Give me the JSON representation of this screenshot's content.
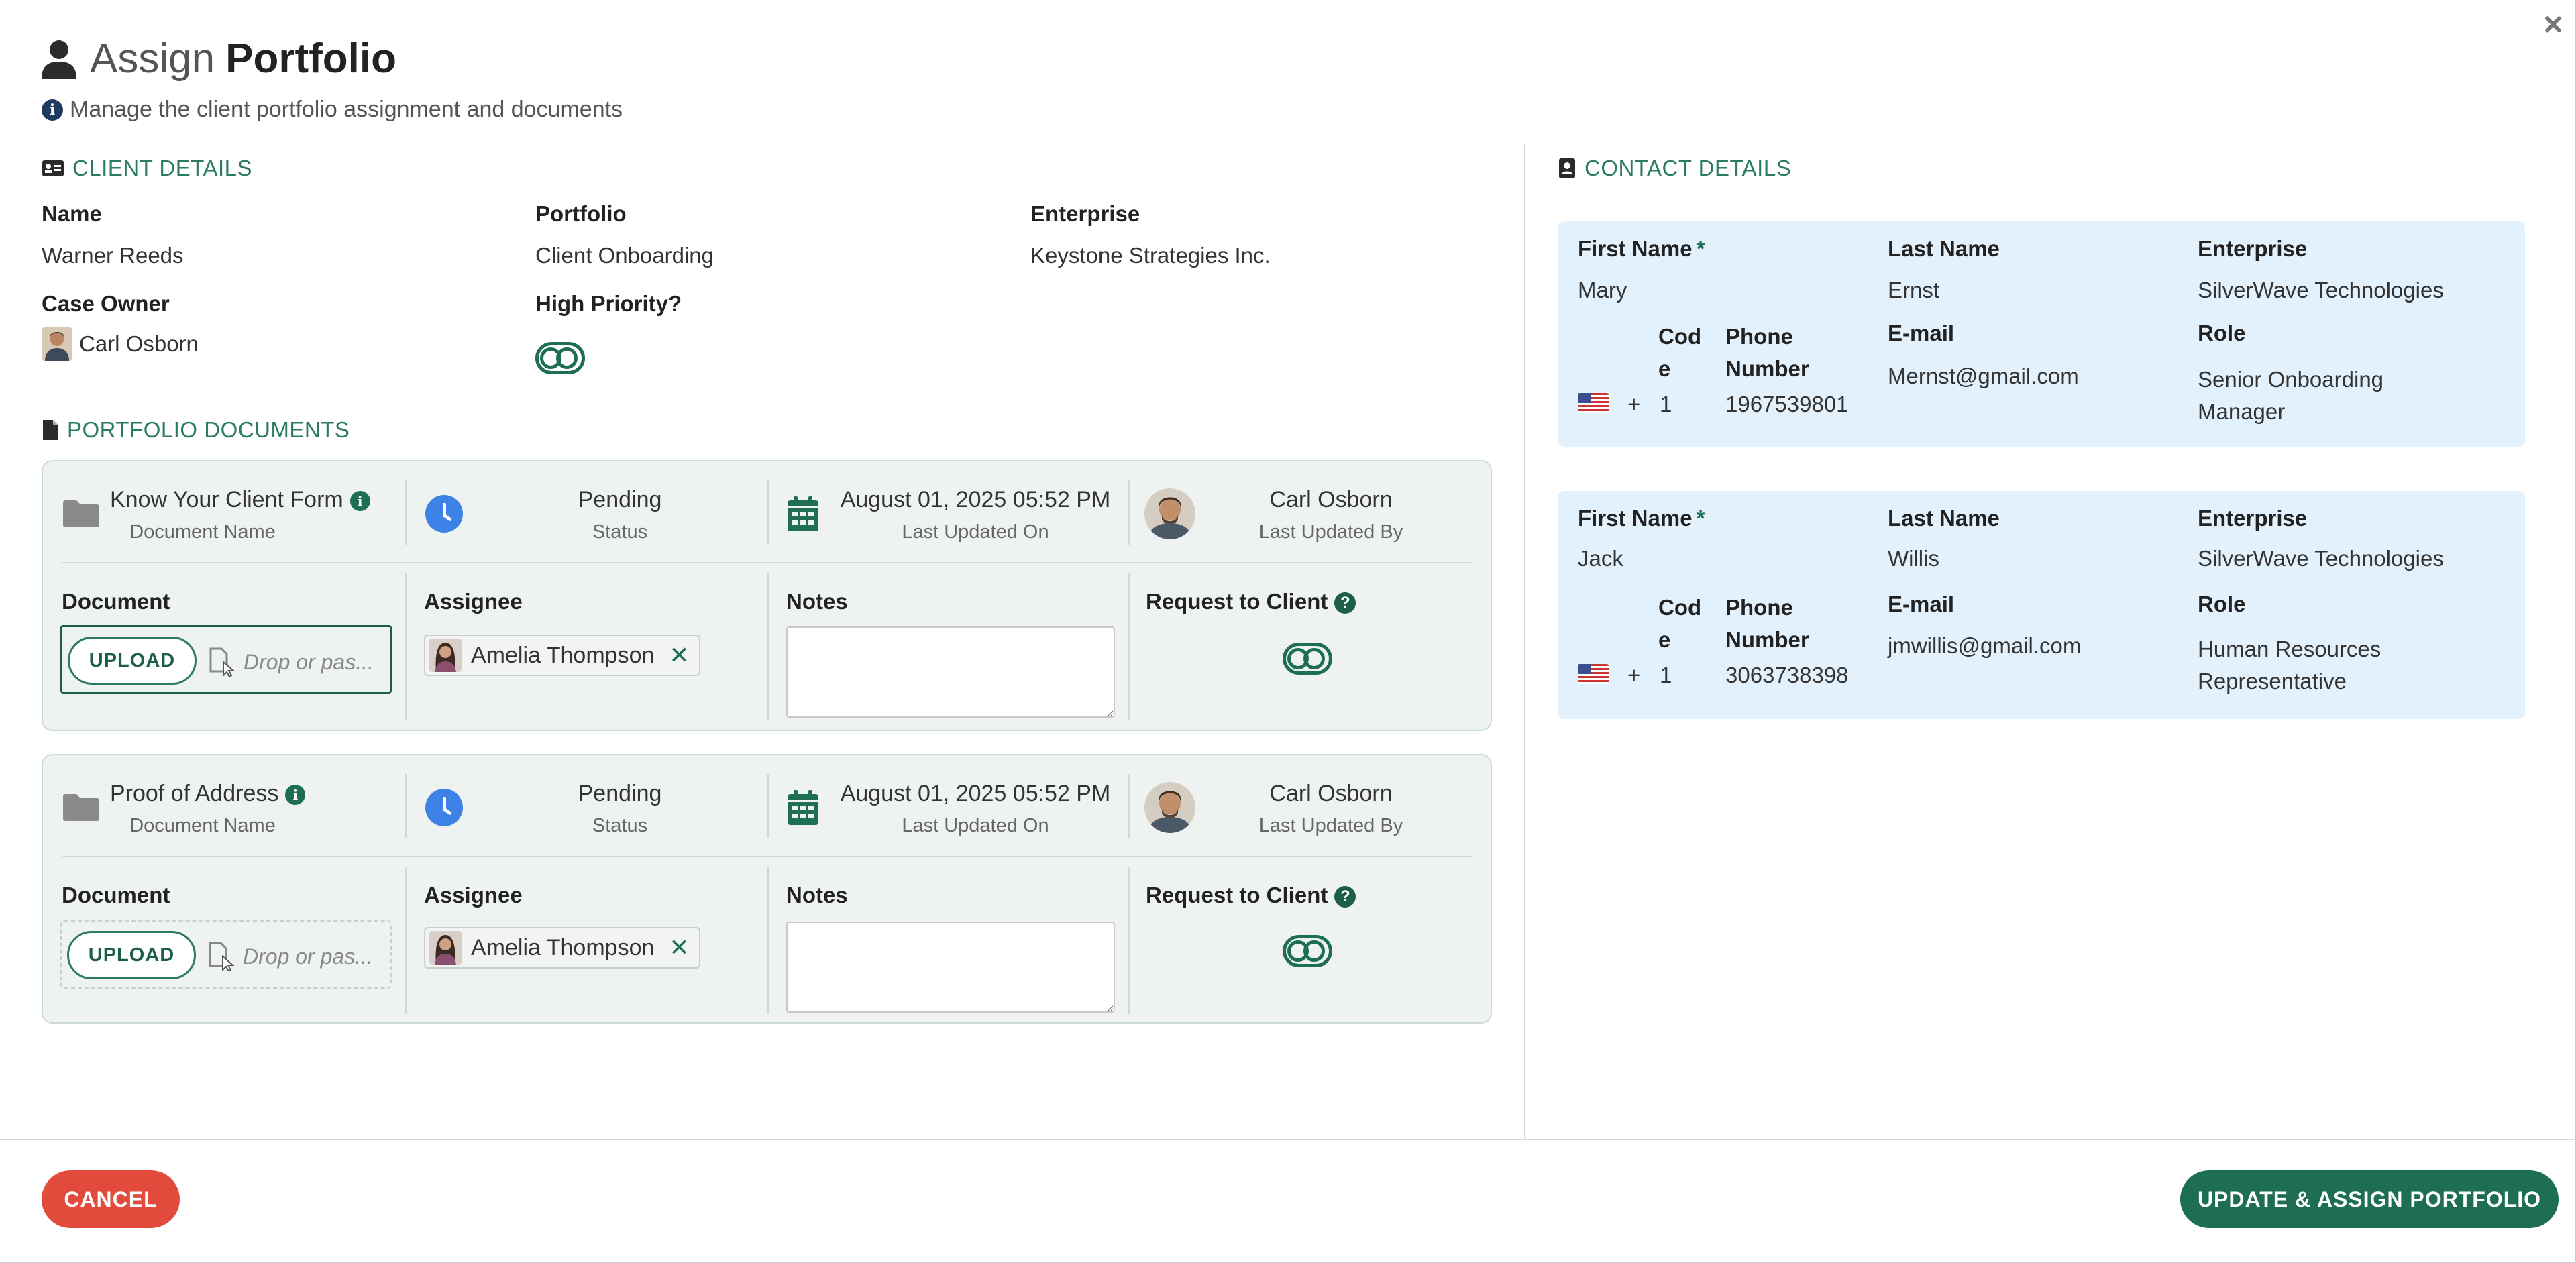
{
  "header": {
    "title_light": "Assign",
    "title_bold": "Portfolio",
    "subtitle": "Manage the client portfolio assignment and documents"
  },
  "client_details": {
    "section_title": "CLIENT DETAILS",
    "name_label": "Name",
    "name_value": "Warner Reeds",
    "portfolio_label": "Portfolio",
    "portfolio_value": "Client Onboarding",
    "enterprise_label": "Enterprise",
    "enterprise_value": "Keystone Strategies Inc.",
    "case_owner_label": "Case Owner",
    "case_owner_value": "Carl Osborn",
    "high_priority_label": "High Priority?"
  },
  "portfolio_documents": {
    "section_title": "PORTFOLIO DOCUMENTS",
    "documents": [
      {
        "name": "Know Your Client Form",
        "name_sub": "Document Name",
        "status": "Pending",
        "status_sub": "Status",
        "updated_on": "August 01, 2025 05:52 PM",
        "updated_on_sub": "Last Updated On",
        "updated_by": "Carl Osborn",
        "updated_by_sub": "Last Updated By",
        "document_label": "Document",
        "upload_label": "UPLOAD",
        "drop_text": "Drop or pas...",
        "assignee_label": "Assignee",
        "assignee": "Amelia Thompson",
        "notes_label": "Notes",
        "notes_value": "",
        "request_label": "Request to Client"
      },
      {
        "name": "Proof of Address",
        "name_sub": "Document Name",
        "status": "Pending",
        "status_sub": "Status",
        "updated_on": "August 01, 2025 05:52 PM",
        "updated_on_sub": "Last Updated On",
        "updated_by": "Carl Osborn",
        "updated_by_sub": "Last Updated By",
        "document_label": "Document",
        "upload_label": "UPLOAD",
        "drop_text": "Drop or pas...",
        "assignee_label": "Assignee",
        "assignee": "Amelia Thompson",
        "notes_label": "Notes",
        "notes_value": "",
        "request_label": "Request to Client"
      }
    ]
  },
  "contact_details": {
    "section_title": "CONTACT DETAILS",
    "labels": {
      "first_name": "First Name",
      "required": "*",
      "last_name": "Last Name",
      "enterprise": "Enterprise",
      "code_1": "Cod",
      "code_2": "e",
      "phone_1": "Phone",
      "phone_2": "Number",
      "email": "E-mail",
      "role": "Role",
      "plus": "+"
    },
    "contacts": [
      {
        "first_name": "Mary",
        "last_name": "Ernst",
        "enterprise": "SilverWave Technologies",
        "code": "1",
        "phone": "1967539801",
        "email": "Mernst@gmail.com",
        "role_1": "Senior Onboarding",
        "role_2": "Manager"
      },
      {
        "first_name": "Jack",
        "last_name": "Willis",
        "enterprise": "SilverWave Technologies",
        "code": "1",
        "phone": "3063738398",
        "email": "jmwillis@gmail.com",
        "role_1": "Human Resources",
        "role_2": "Representative"
      }
    ]
  },
  "footer": {
    "cancel_label": "CANCEL",
    "assign_label": "UPDATE & ASSIGN PORTFOLIO"
  },
  "colors": {
    "accent": "#1d6e55",
    "section": "#2b7a62",
    "cancel": "#e24b3c",
    "contact_bg": "#e3f1fc",
    "card_bg": "#eef3f1"
  },
  "icons": [
    "user-icon",
    "info-icon",
    "id-card-icon",
    "document-icon",
    "contact-book-icon",
    "folder-icon",
    "clock-icon",
    "calendar-icon",
    "file-cursor-icon",
    "remove-icon",
    "help-icon",
    "us-flag-icon",
    "close-icon"
  ]
}
